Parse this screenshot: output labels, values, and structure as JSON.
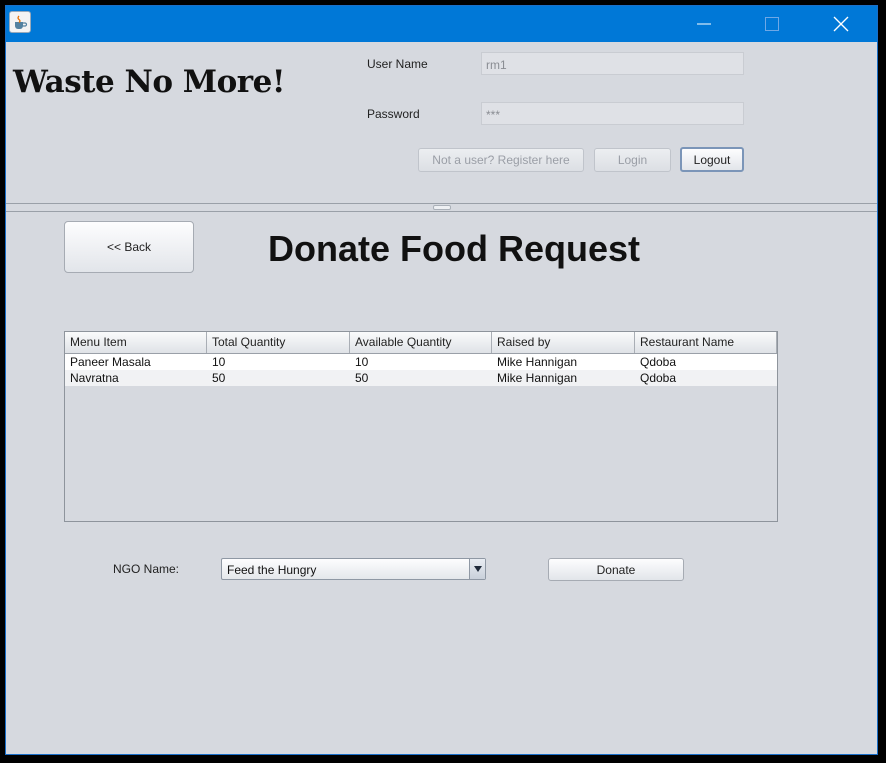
{
  "window": {
    "controls": {
      "minimize_icon": "minimize-icon",
      "maximize_icon": "maximize-icon",
      "close_icon": "close-icon"
    },
    "app_icon": "java-cup-icon"
  },
  "header": {
    "brand": "Waste No More!",
    "username_label": "User Name",
    "username_value": "rm1",
    "password_label": "Password",
    "password_value": "***",
    "register_label": "Not a user? Register here",
    "login_label": "Login",
    "logout_label": "Logout"
  },
  "main": {
    "back_label": "<< Back",
    "title": "Donate Food Request",
    "table": {
      "columns": [
        "Menu Item",
        "Total Quantity",
        "Available Quantity",
        "Raised by",
        "Restaurant Name"
      ],
      "rows": [
        [
          "Paneer Masala",
          "10",
          "10",
          "Mike Hannigan",
          "Qdoba"
        ],
        [
          "Navratna",
          "50",
          "50",
          "Mike Hannigan",
          "Qdoba"
        ]
      ]
    },
    "ngo_label": "NGO Name:",
    "ngo_selected": "Feed the Hungry",
    "donate_label": "Donate"
  },
  "colors": {
    "titlebar": "#0078d7",
    "background": "#d6d9df"
  }
}
